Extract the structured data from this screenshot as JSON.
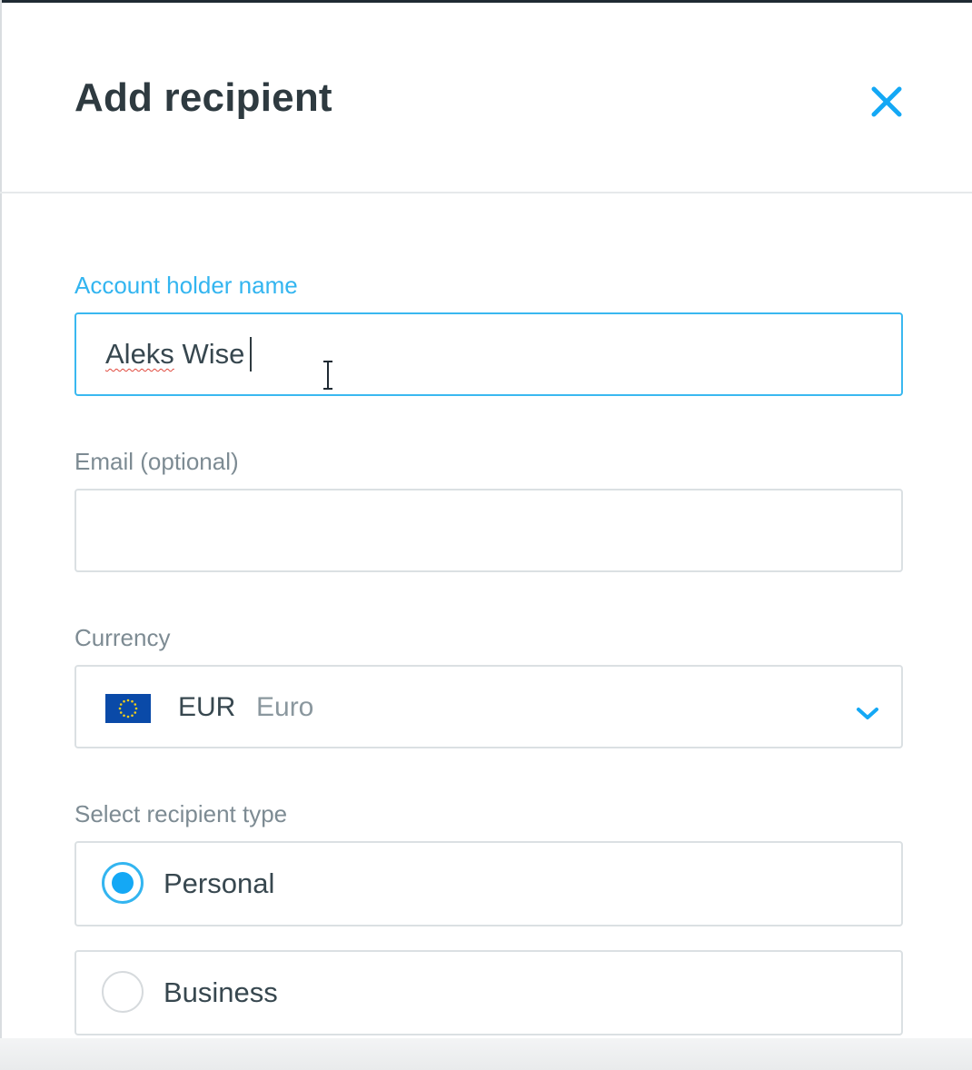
{
  "dialog": {
    "title": "Add recipient"
  },
  "form": {
    "account_holder": {
      "label": "Account holder name",
      "value": "Aleks Wise",
      "first_word": "Aleks",
      "second_word": "Wise"
    },
    "email": {
      "label": "Email (optional)",
      "value": ""
    },
    "currency": {
      "label": "Currency",
      "code": "EUR",
      "name": "Euro",
      "flag_icon": "eu-flag-icon"
    },
    "recipient_type": {
      "label": "Select recipient type",
      "options": [
        {
          "label": "Personal",
          "selected": true
        },
        {
          "label": "Business",
          "selected": false
        }
      ]
    }
  },
  "colors": {
    "accent": "#33b5f0",
    "text": "#37474f",
    "muted": "#7d8b93",
    "border": "#dbe0e3"
  },
  "icons": [
    "close-icon",
    "chevron-down-icon",
    "eu-flag-icon",
    "text-cursor-icon"
  ]
}
